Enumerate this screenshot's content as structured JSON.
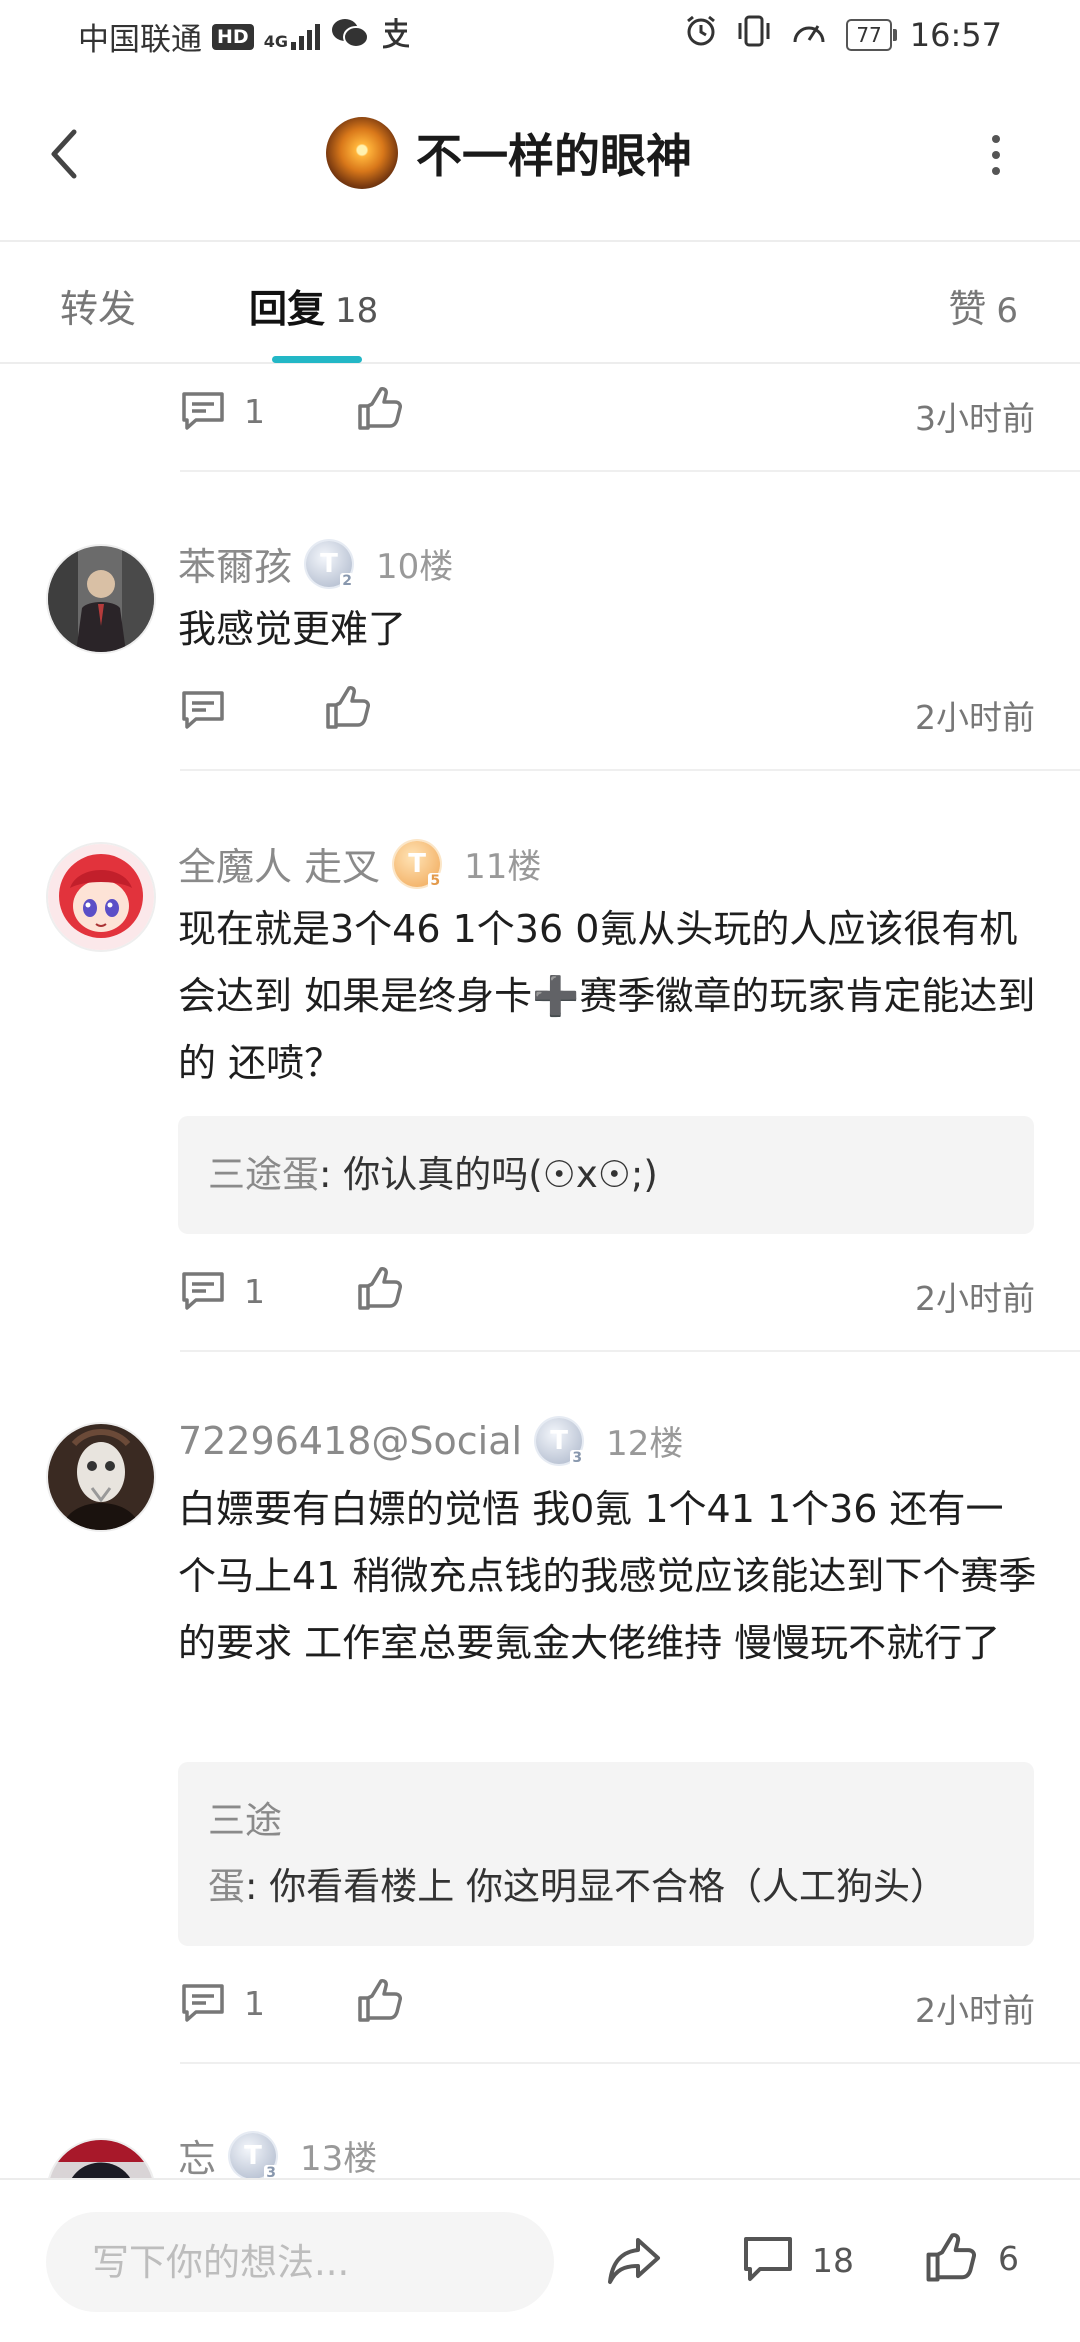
{
  "status_bar": {
    "carrier": "中国联通",
    "hd": "HD",
    "network": "4G",
    "battery": "77",
    "time": "16:57"
  },
  "header": {
    "title": "不一样的眼神"
  },
  "tabs": {
    "forward_label": "转发",
    "reply_label": "回复",
    "reply_count": "18",
    "like_label": "赞",
    "like_count": "6"
  },
  "top_actions": {
    "comment_count": "1",
    "time": "3小时前"
  },
  "replies": [
    {
      "username": "苯爾孩",
      "badge": "T",
      "badge_level": "2",
      "floor": "10楼",
      "content": "我感觉更难了",
      "comment_count": "",
      "time": "2小时前"
    },
    {
      "username": "全魔人 走叉",
      "badge": "T",
      "badge_level": "5",
      "floor": "11楼",
      "content": "现在就是3个46 1个36   0氪从头玩的人应该很有机会达到 如果是终身卡➕赛季徽章的玩家肯定能达到的 还喷？",
      "quote_user": "三途蛋",
      "quote_text": ": 你认真的吗(☉x☉;)",
      "comment_count": "1",
      "time": "2小时前"
    },
    {
      "username": "72296418@Social",
      "badge": "T",
      "badge_level": "3",
      "floor": "12楼",
      "content": "白嫖要有白嫖的觉悟   我0氪  1个41  1个36   还有一个马上41  稍微充点钱的我感觉应该能达到下个赛季的要求    工作室总要氪金大佬维持 慢慢玩不就行了",
      "quote_user": "三途蛋",
      "quote_text": ": 你看看楼上 你这明显不合格（人工狗头）",
      "comment_count": "1",
      "time": "2小时前"
    },
    {
      "username": "忘",
      "badge": "T",
      "badge_level": "3",
      "floor": "13楼"
    }
  ],
  "bottom_bar": {
    "placeholder": "写下你的想法...",
    "comment_count": "18",
    "like_count": "6"
  }
}
